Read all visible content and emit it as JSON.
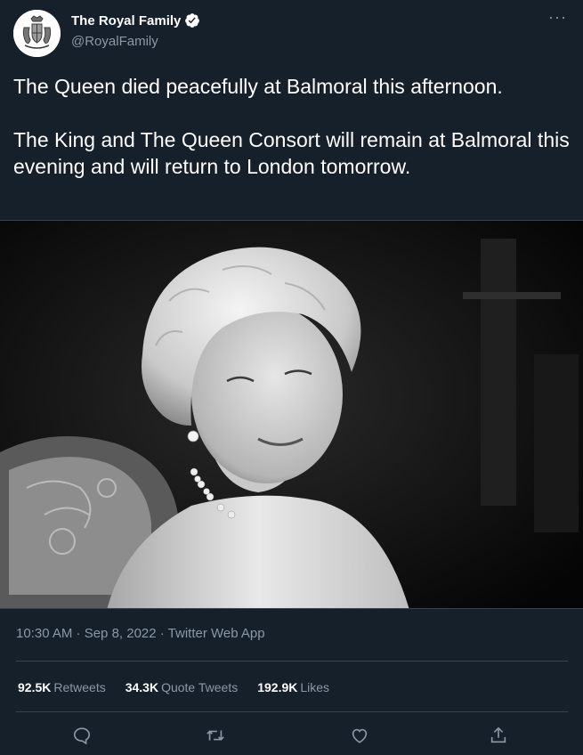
{
  "account": {
    "display_name": "The Royal Family",
    "handle": "@RoyalFamily",
    "verified": true,
    "avatar_icon": "royal-coat-of-arms"
  },
  "tweet": {
    "text": "The Queen died peacefully at Balmoral this afternoon.\n\nThe King and The Queen Consort will remain at Balmoral this evening and will return to London tomorrow.",
    "photo_icon": "black-and-white-portrait-photo"
  },
  "meta": {
    "timestamp": "10:30 AM · Sep 8, 2022 · Twitter Web App"
  },
  "stats": {
    "retweets_count": "92.5K",
    "retweets_label": "Retweets",
    "quote_tweets_count": "34.3K",
    "quote_tweets_label": "Quote Tweets",
    "likes_count": "192.9K",
    "likes_label": "Likes"
  },
  "actions": [
    "reply-icon",
    "retweet-icon",
    "like-icon",
    "share-icon"
  ],
  "colors": {
    "background": "#15202b",
    "text": "#ffffff",
    "secondary_text": "#8b98a5",
    "divider": "#38444d",
    "verified": "#ffffff"
  }
}
